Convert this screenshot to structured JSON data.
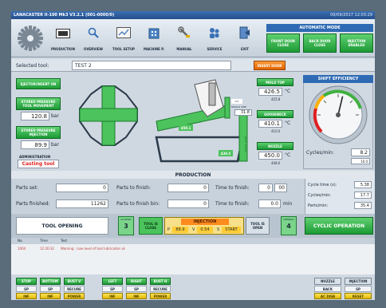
{
  "title_bar": {
    "title": "LANACASTER II-100 Mk3 V3.2.1 (001-0000/0)",
    "datetime": "09/09/2017 12:03:29"
  },
  "toolbar": {
    "logo": "gear-logo",
    "buttons": [
      {
        "label": "PRODUCTION",
        "icon": "production-icon"
      },
      {
        "label": "OVERVIEW",
        "icon": "magnifier-icon"
      },
      {
        "label": "TOOL SETUP",
        "icon": "tool-setup-icon"
      },
      {
        "label": "MACHINE P.",
        "icon": "building-icon"
      },
      {
        "label": "MANUAL",
        "icon": "wrench-icon"
      },
      {
        "label": "SERVICE",
        "icon": "service-icon"
      },
      {
        "label": "EXIT",
        "icon": "exit-icon"
      }
    ],
    "mode_title": "AUTOMATIC MODE",
    "mode_buttons": [
      "FRONT DOOR CLOSE",
      "BACK DOOR CLOSE",
      "INJECTION ENABLED"
    ]
  },
  "selected_tool": {
    "label": "Selected tool:",
    "value": "TEST 2",
    "button": "INSERT DOOR"
  },
  "left_controls": {
    "ejector_button": "EJECTOR/INSERT ON",
    "pressure_button": "STORED PRESSURE TOOL MOVEMENT",
    "pressure_value": "120.8",
    "pressure_unit": "bar",
    "injection_pressure_button": "STORED PRESSURE INJECTION",
    "injection_value": "89.9",
    "injection_unit": "bar",
    "admin_label": "ADMINISTRATION",
    "admin_status": "Casting tool"
  },
  "machine_diagram": {
    "label_left": "450.1",
    "label_right": "430.5",
    "label_small": "0.0",
    "vertical_label": "METAL LEVEL"
  },
  "temperatures": {
    "mould_top": {
      "label": "MOLD TOP",
      "value": "426.5",
      "unit": "°C",
      "sub": "425.8"
    },
    "mould_side": {
      "label": "MOULD SIDE",
      "value": "31.8"
    },
    "gooseneck": {
      "label": "GOOSENECK",
      "value": "410.1",
      "unit": "°C",
      "sub": "410.0"
    },
    "nozzle": {
      "label": "NOZZLE",
      "value": "450.0",
      "unit": "°C",
      "sub": "448.0"
    }
  },
  "shift_efficiency": {
    "title": "SHIFT EFFICIENCY",
    "gauge_value": 0.55,
    "cycles_label": "Cycles/min:",
    "cycles_value": "8.2",
    "cycles_sub": "10.0"
  },
  "production": {
    "title": "PRODUCTION",
    "parts_set_label": "Parts set:",
    "parts_set_value": "0",
    "parts_finished_label": "Parts finished:",
    "parts_finished_value": "11262",
    "parts_to_finish_label": "Parts to finish:",
    "parts_to_finish_value": "0",
    "parts_to_finish_bin_label": "Parts to finish bin:",
    "parts_to_finish_bin_value": "0",
    "time_to_finish_label": "Time to finish:",
    "time_to_finish_h": "0",
    "time_to_finish_m": "00",
    "time_to_finish2_label": "Time to finish:",
    "time_to_finish2_value": "0.0",
    "time_to_finish2_unit": "min",
    "cycle_time_label": "Cycle time (s):",
    "cycle_time_value": "5.38",
    "cycles_min_label": "Cycles/min:",
    "cycles_min_value": "17.7",
    "parts_min_label": "Parts/min:",
    "parts_min_value": "35.4"
  },
  "cycle_bar": {
    "tool_opening": "TOOL OPENING",
    "step_closing_label": "CLOSING",
    "step_closing_num": "3",
    "tool_is_close": "TOOL IS CLOSE",
    "injection_title": "INJECTION",
    "inj_p_label": "P",
    "inj_p_value": "88.9",
    "inj_v_label": "V",
    "inj_v_value": "0.54",
    "inj_s_label": "S",
    "inj_s_value": "START",
    "tool_is_open": "TOOL IS OPEN",
    "step_opening_label": "OPENING",
    "step_opening_num": "4",
    "cyclic_operation": "CYCLIC OPERATION"
  },
  "alarm_list": {
    "headers": [
      "No.",
      "Time",
      "Text"
    ],
    "rows": [
      {
        "no": "1004",
        "time": "12:26:32",
        "text": "Warning : Low level of tool lubrication oil"
      }
    ]
  },
  "bottom_buttons": {
    "group1": [
      {
        "label": "STOP",
        "sub": "SP",
        "sub2": "INF"
      },
      {
        "label": "BOTTOM",
        "sub": "SP",
        "sub2": "INF"
      },
      {
        "label": "BUST V",
        "sub": "RECURE",
        "sub2": "POWER"
      }
    ],
    "group2": [
      {
        "label": "LEFT",
        "sub": "SP",
        "sub2": "INF"
      },
      {
        "label": "RIGHT",
        "sub": "SP",
        "sub2": "INF"
      },
      {
        "label": "BUST H",
        "sub": "RECURE",
        "sub2": "POWER"
      }
    ],
    "group3": [
      {
        "label": "NOZZLE",
        "sub": "BACK",
        "sub2": "AC DISB"
      },
      {
        "label": "INJECTION",
        "sub": "SP",
        "sub2": "RESET"
      }
    ]
  }
}
